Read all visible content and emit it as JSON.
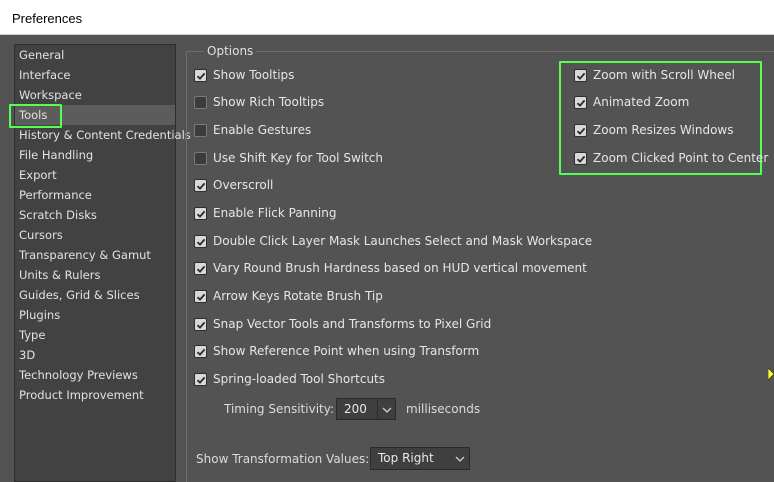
{
  "window": {
    "title": "Preferences"
  },
  "sidebar": {
    "items": [
      {
        "label": "General"
      },
      {
        "label": "Interface"
      },
      {
        "label": "Workspace"
      },
      {
        "label": "Tools"
      },
      {
        "label": "History & Content Credentials"
      },
      {
        "label": "File Handling"
      },
      {
        "label": "Export"
      },
      {
        "label": "Performance"
      },
      {
        "label": "Scratch Disks"
      },
      {
        "label": "Cursors"
      },
      {
        "label": "Transparency & Gamut"
      },
      {
        "label": "Units & Rulers"
      },
      {
        "label": "Guides, Grid & Slices"
      },
      {
        "label": "Plugins"
      },
      {
        "label": "Type"
      },
      {
        "label": "3D"
      },
      {
        "label": "Technology Previews"
      },
      {
        "label": "Product Improvement"
      }
    ],
    "selected": "Tools"
  },
  "options": {
    "group_label": "Options",
    "left": [
      {
        "label": "Show Tooltips",
        "checked": true
      },
      {
        "label": "Show Rich Tooltips",
        "checked": false
      },
      {
        "label": "Enable Gestures",
        "checked": false
      },
      {
        "label": "Use Shift Key for Tool Switch",
        "checked": false
      },
      {
        "label": "Overscroll",
        "checked": true
      },
      {
        "label": "Enable Flick Panning",
        "checked": true
      },
      {
        "label": "Double Click Layer Mask Launches Select and Mask Workspace",
        "checked": true
      },
      {
        "label": "Vary Round Brush Hardness based on HUD vertical movement",
        "checked": true
      },
      {
        "label": "Arrow Keys Rotate Brush Tip",
        "checked": true
      },
      {
        "label": "Snap Vector Tools and Transforms to Pixel Grid",
        "checked": true
      },
      {
        "label": "Show Reference Point when using Transform",
        "checked": true
      },
      {
        "label": "Spring-loaded Tool Shortcuts",
        "checked": true
      }
    ],
    "right": [
      {
        "label": "Zoom with Scroll Wheel",
        "checked": true
      },
      {
        "label": "Animated Zoom",
        "checked": true
      },
      {
        "label": "Zoom Resizes Windows",
        "checked": true
      },
      {
        "label": "Zoom Clicked Point to Center",
        "checked": true
      }
    ],
    "timing": {
      "label": "Timing Sensitivity:",
      "value": "200",
      "unit": "milliseconds"
    },
    "transformation": {
      "label": "Show Transformation Values:",
      "value": "Top Right"
    }
  },
  "colors": {
    "highlight": "#54ff54",
    "background": "#535353"
  }
}
